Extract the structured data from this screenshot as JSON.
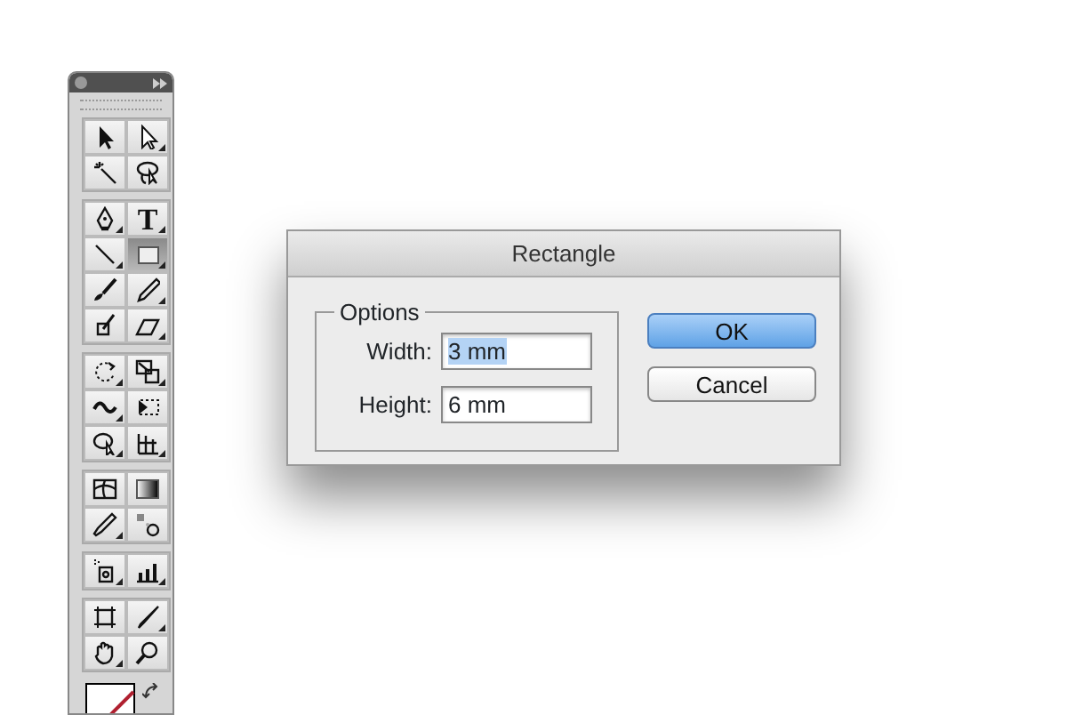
{
  "tools_panel": {
    "tool_groups": [
      [
        {
          "kind": "selection",
          "flyout": false,
          "selected": false
        },
        {
          "kind": "direct-selection",
          "flyout": true,
          "selected": false
        },
        {
          "kind": "magic-wand",
          "flyout": false,
          "selected": false
        },
        {
          "kind": "lasso",
          "flyout": false,
          "selected": false
        }
      ],
      [
        {
          "kind": "pen",
          "flyout": true,
          "selected": false
        },
        {
          "kind": "type",
          "label": "T",
          "flyout": true,
          "selected": false
        },
        {
          "kind": "line",
          "flyout": true,
          "selected": false
        },
        {
          "kind": "rectangle",
          "flyout": true,
          "selected": true
        },
        {
          "kind": "paintbrush",
          "flyout": false,
          "selected": false
        },
        {
          "kind": "pencil",
          "flyout": true,
          "selected": false
        },
        {
          "kind": "blob-brush",
          "flyout": false,
          "selected": false
        },
        {
          "kind": "eraser",
          "flyout": true,
          "selected": false
        }
      ],
      [
        {
          "kind": "rotate",
          "flyout": true,
          "selected": false
        },
        {
          "kind": "scale",
          "flyout": true,
          "selected": false
        },
        {
          "kind": "warp",
          "flyout": true,
          "selected": false
        },
        {
          "kind": "free-transform",
          "flyout": false,
          "selected": false
        },
        {
          "kind": "shape-builder",
          "flyout": true,
          "selected": false
        },
        {
          "kind": "perspective-grid",
          "flyout": true,
          "selected": false
        }
      ],
      [
        {
          "kind": "mesh",
          "flyout": false,
          "selected": false
        },
        {
          "kind": "gradient",
          "flyout": false,
          "selected": false
        },
        {
          "kind": "eyedropper",
          "flyout": true,
          "selected": false
        },
        {
          "kind": "blend",
          "flyout": false,
          "selected": false
        }
      ],
      [
        {
          "kind": "symbol-sprayer",
          "flyout": true,
          "selected": false
        },
        {
          "kind": "column-graph",
          "flyout": true,
          "selected": false
        }
      ],
      [
        {
          "kind": "artboard",
          "flyout": false,
          "selected": false
        },
        {
          "kind": "slice",
          "flyout": true,
          "selected": false
        },
        {
          "kind": "hand",
          "flyout": true,
          "selected": false
        },
        {
          "kind": "zoom",
          "flyout": false,
          "selected": false
        }
      ]
    ]
  },
  "dialog": {
    "title": "Rectangle",
    "group_title": "Options",
    "fields": [
      {
        "label": "Width:",
        "value": "3 mm",
        "text_selected": true
      },
      {
        "label": "Height:",
        "value": "6 mm",
        "text_selected": false
      }
    ],
    "buttons": [
      {
        "label": "OK",
        "default": true
      },
      {
        "label": "Cancel",
        "default": false
      }
    ]
  }
}
